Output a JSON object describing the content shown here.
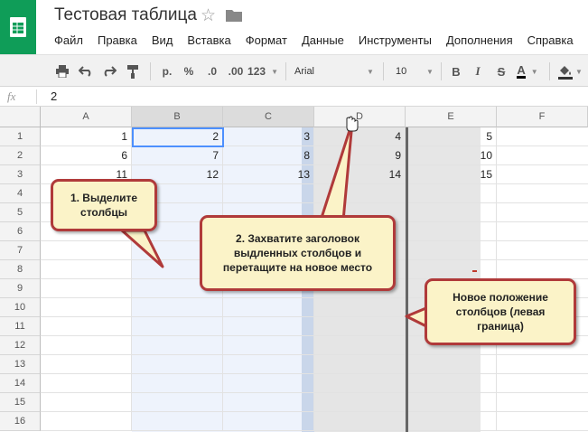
{
  "app": {
    "doc_title": "Тестовая таблица",
    "menu": [
      "Файл",
      "Правка",
      "Вид",
      "Вставка",
      "Формат",
      "Данные",
      "Инструменты",
      "Дополнения",
      "Справка"
    ]
  },
  "toolbar": {
    "currency": "р.",
    "percent": "%",
    "dec_decrease": ".0",
    "dec_increase": ".00",
    "number_format": "123",
    "font": "Arial",
    "font_size": "10",
    "bold": "B",
    "italic": "I",
    "strike": "S",
    "text_color": "A"
  },
  "formula_bar": {
    "fx": "fx",
    "value": "2"
  },
  "grid": {
    "columns": [
      "A",
      "B",
      "C",
      "D",
      "E",
      "F"
    ],
    "rows": [
      "1",
      "2",
      "3",
      "4",
      "5",
      "6",
      "7",
      "8",
      "9",
      "10",
      "11",
      "12",
      "13",
      "14",
      "15",
      "16"
    ],
    "cells": [
      [
        "1",
        "2",
        "3",
        "4",
        "5"
      ],
      [
        "6",
        "7",
        "8",
        "9",
        "10"
      ],
      [
        "11",
        "12",
        "13",
        "14",
        "15"
      ]
    ]
  },
  "annotations": {
    "step1": "1. Выделите столбцы",
    "step2": "2. Захватите заголовок выдленных столбцов и перетащите на новое место",
    "new_position": "Новое положение столбцов (левая граница)"
  },
  "colors": {
    "logo_green": "#0f9d58",
    "selection_blue": "#eef3fc",
    "active_border": "#4d90fe",
    "callout_fill": "#fbf3c8",
    "callout_border": "#b03a3a"
  }
}
